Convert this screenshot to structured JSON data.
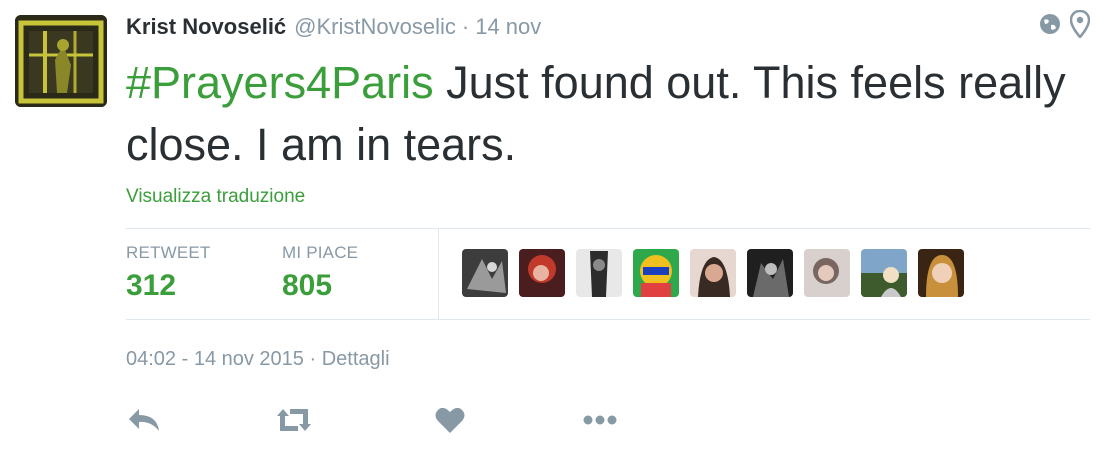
{
  "tweet": {
    "author": {
      "name": "Krist Novoselić",
      "handle": "@KristNovoselic"
    },
    "separator": "·",
    "time": "14 nov",
    "hashtag": "#Prayers4Paris",
    "text": " Just found out. This feels really close. I am in tears.",
    "translate_label": "Visualizza traduzione",
    "stats": {
      "retweet_label": "RETWEET",
      "retweet_count": "312",
      "likes_label": "MI PIACE",
      "likes_count": "805"
    },
    "datetime": "04:02 - 14 nov 2015",
    "details_label": "Dettagli",
    "colors": {
      "accent": "#3a9e3a",
      "muted": "#8899a6",
      "text": "#292f33",
      "border": "#e1e8ed"
    },
    "icons": [
      "globe-icon",
      "location-pin-icon",
      "reply-icon",
      "retweet-icon",
      "heart-icon",
      "more-icon"
    ]
  }
}
